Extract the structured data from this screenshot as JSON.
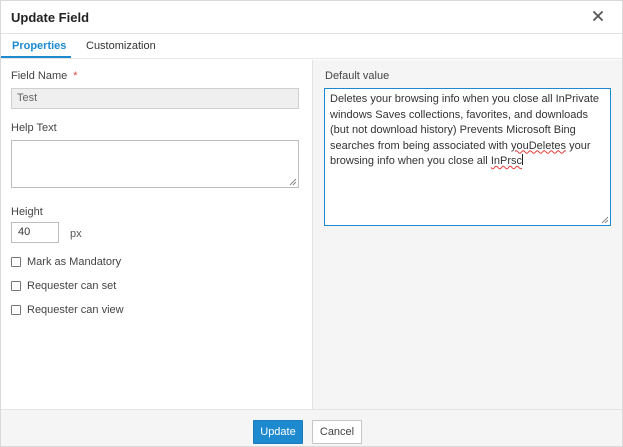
{
  "dialog": {
    "title": "Update Field",
    "close_icon": "close-icon"
  },
  "tabs": [
    {
      "label": "Properties",
      "active": true
    },
    {
      "label": "Customization",
      "active": false
    }
  ],
  "left": {
    "field_name_label": "Field Name",
    "required_mark": "*",
    "field_name_value": "Test",
    "help_text_label": "Help Text",
    "help_text_value": "",
    "height_label": "Height",
    "height_value": "40",
    "height_unit": "px",
    "checkboxes": [
      {
        "label": "Mark as Mandatory",
        "checked": false
      },
      {
        "label": "Requester can set",
        "checked": false
      },
      {
        "label": "Requester can view",
        "checked": false
      }
    ]
  },
  "right": {
    "default_value_label": "Default value",
    "default_value_text_main": "Deletes your browsing info when you close all InPrivate windows Saves collections, favorites, and downloads (but not download history) Prevents Microsoft Bing searches from being associated with ",
    "default_value_spell_1": "youDeletes",
    "default_value_text_mid": " your browsing info when you close all ",
    "default_value_spell_2": "InPrsc"
  },
  "footer": {
    "update_label": "Update",
    "cancel_label": "Cancel"
  },
  "colors": {
    "accent": "#1d8ad0",
    "required": "#e24a4a"
  }
}
